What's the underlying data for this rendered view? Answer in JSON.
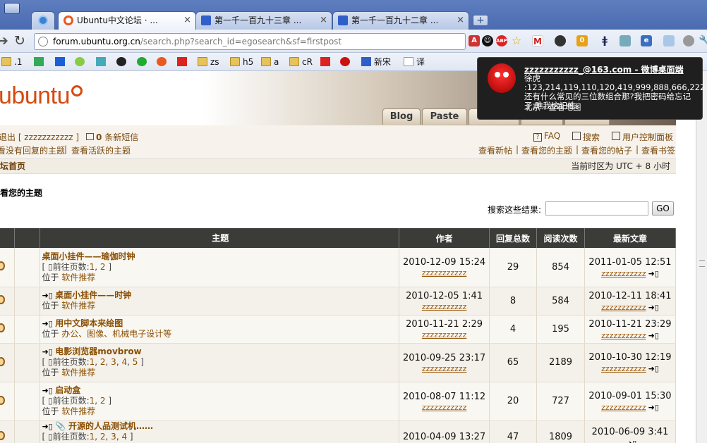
{
  "tabs": [
    {
      "title": "Ubuntu中文论坛 · ...",
      "active": true
    },
    {
      "title": "第一千一百九十三章 ...",
      "active": false
    },
    {
      "title": "第一千一百九十二章 ...",
      "active": false
    }
  ],
  "address": {
    "domain": "forum.ubuntu.org.cn",
    "path": "/search.php?search_id=egosearch&sf=firstpost"
  },
  "bookmarks": [
    ".1",
    "zs",
    "h5",
    "a",
    "cR",
    "新宋",
    "译"
  ],
  "site": {
    "logo": "ubuntu",
    "nav_tabs": [
      "Blog",
      "Paste"
    ],
    "logout": "退出 [ zzzzzzzzzzz ]",
    "pm_count": "0",
    "pm_label": "条新短信",
    "faq": "FAQ",
    "search": "搜索",
    "ucp": "用户控制面板",
    "unanswered": "看没有回复的主题",
    "active_topics": "查看活跃的主题",
    "new_posts": "查看新帖",
    "your_topics": "查看您的主题",
    "your_posts": "查看您的帖子",
    "bookmarks": "查看书签",
    "home": "坛首页",
    "timezone": "当前时区为 UTC + 8 小时",
    "page_title": "看您的主题",
    "search_label": "搜索这些结果:",
    "go": "GO"
  },
  "table": {
    "headers": [
      "主题",
      "作者",
      "回复总数",
      "阅读次数",
      "最新文章"
    ],
    "rows": [
      {
        "title": "桌面小挂件——瑜伽时钟",
        "pages": [
          "1",
          "2"
        ],
        "location": "软件推荐",
        "created": "2010-12-09 15:24",
        "author": "zzzzzzzzzzz",
        "replies": "29",
        "views": "854",
        "last": "2011-01-05 12:51",
        "last_author": "zzzzzzzzzzz",
        "attach": false
      },
      {
        "title": "桌面小挂件——时钟",
        "pages": [],
        "location": "软件推荐",
        "created": "2010-12-05 1:41",
        "author": "zzzzzzzzzzz",
        "replies": "8",
        "views": "584",
        "last": "2010-12-11 18:41",
        "last_author": "zzzzzzzzzzz",
        "attach": false
      },
      {
        "title": "用中文脚本来绘图",
        "pages": [],
        "location": "办公、图像、机械电子设计等",
        "created": "2010-11-21 2:29",
        "author": "zzzzzzzzzzz",
        "replies": "4",
        "views": "195",
        "last": "2010-11-21 23:29",
        "last_author": "zzzzzzzzzzz",
        "attach": false
      },
      {
        "title": "电影浏览器movbrow",
        "pages": [
          "1",
          "2",
          "3",
          "4",
          "5"
        ],
        "location": "软件推荐",
        "created": "2010-09-25 23:17",
        "author": "zzzzzzzzzzz",
        "replies": "65",
        "views": "2189",
        "last": "2010-10-30 12:19",
        "last_author": "zzzzzzzzzzz",
        "attach": false
      },
      {
        "title": "启动盒",
        "pages": [
          "1",
          "2"
        ],
        "location": "软件推荐",
        "created": "2010-08-07 11:12",
        "author": "zzzzzzzzzzz",
        "replies": "20",
        "views": "727",
        "last": "2010-09-01 15:30",
        "last_author": "zzzzzzzzzzz",
        "attach": false
      },
      {
        "title": "开源的人品测试机……",
        "pages": [
          "1",
          "2",
          "3",
          "4"
        ],
        "location": "",
        "created": "2010-04-09 13:27",
        "author": "",
        "replies": "47",
        "views": "1809",
        "last": "2010-06-09 3:41",
        "last_author": "",
        "attach": true
      }
    ],
    "goto_label": "前往页数:",
    "loc_label": "位于"
  },
  "notification": {
    "header": "zzzzzzzzzzz_@163.com - 微博桌面端",
    "body": "徐虎 :123,214,119,110,120,419,999,888,666,222还有什么常见的三位数组合那?我把密码给忘记了,瞧我这记性。",
    "footer": "北京 - 查看地图"
  },
  "colors": {
    "ubuntu_orange": "#d64b10",
    "link_brown": "#8a4e00",
    "table_header": "#3b3b37"
  }
}
